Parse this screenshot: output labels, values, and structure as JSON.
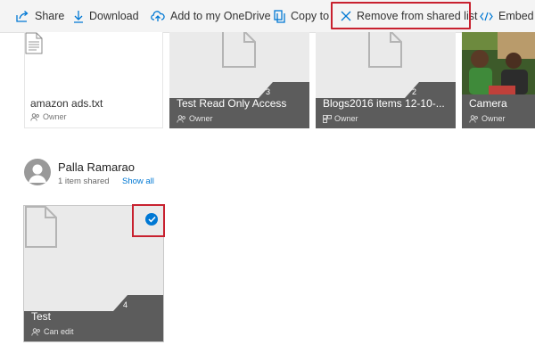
{
  "toolbar": {
    "share": "Share",
    "download": "Download",
    "add_onedrive": "Add to my OneDrive",
    "copy_to": "Copy to",
    "remove_shared": "Remove from shared list",
    "embed": "Embed"
  },
  "top_row": [
    {
      "name": "amazon ads.txt",
      "role": "Owner"
    },
    {
      "name": "Test Read Only Access",
      "role": "Owner",
      "count": "3"
    },
    {
      "name": "Blogs2016 items 12-10-...",
      "role": "Owner",
      "count": "2"
    },
    {
      "name": "Camera",
      "role": "Owner"
    }
  ],
  "person": {
    "name": "Palla Ramarao",
    "items_shared": "1 item shared",
    "show_all": "Show all"
  },
  "selected_item": {
    "name": "Test",
    "permission": "Can edit",
    "count": "4",
    "selected": true
  },
  "colors": {
    "accent": "#0078d4",
    "highlight_border": "#c8212f",
    "tile_bar": "#5c5c5c"
  }
}
